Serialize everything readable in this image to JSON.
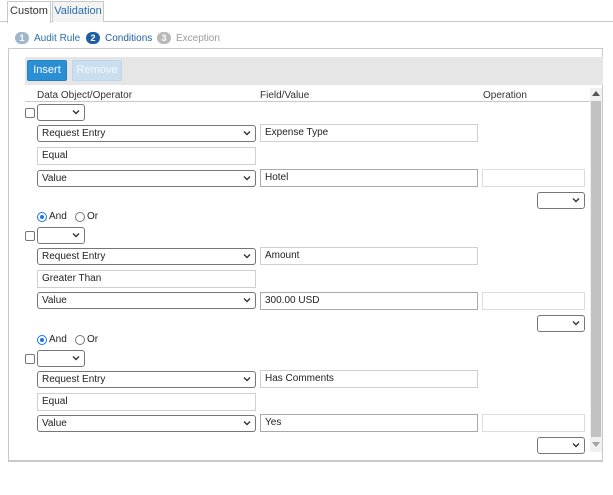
{
  "tabs": [
    {
      "label": "Custom",
      "active": true
    },
    {
      "label": "Validation",
      "active": false
    }
  ],
  "steps": [
    {
      "num": "1",
      "label": "Audit Rule",
      "state": "done"
    },
    {
      "num": "2",
      "label": "Conditions",
      "state": "current"
    },
    {
      "num": "3",
      "label": "Exception",
      "state": "todo"
    }
  ],
  "toolbar": {
    "insert_label": "Insert",
    "remove_label": "Remove"
  },
  "table": {
    "headers": {
      "col1": "Data Object/Operator",
      "col2": "Field/Value",
      "col3": "Operation"
    }
  },
  "conditions": [
    {
      "object_type": "Request Entry",
      "field": "Expense Type",
      "operator": "Equal",
      "value_type": "Value",
      "value": "Hotel",
      "operation_value": ""
    },
    {
      "object_type": "Request Entry",
      "field": "Amount",
      "operator": "Greater Than",
      "value_type": "Value",
      "value": "300.00 USD",
      "operation_value": ""
    },
    {
      "object_type": "Request Entry",
      "field": "Has Comments",
      "operator": "Equal",
      "value_type": "Value",
      "value": "Yes",
      "operation_value": ""
    }
  ],
  "connectors": [
    {
      "and_label": "And",
      "or_label": "Or",
      "selected": "And"
    },
    {
      "and_label": "And",
      "or_label": "Or",
      "selected": "And"
    }
  ],
  "colors": {
    "accent": "#2b8fd6",
    "step_current": "#1e5f9e",
    "link": "#2b6fae",
    "radio_selected": "#1a73e8"
  }
}
